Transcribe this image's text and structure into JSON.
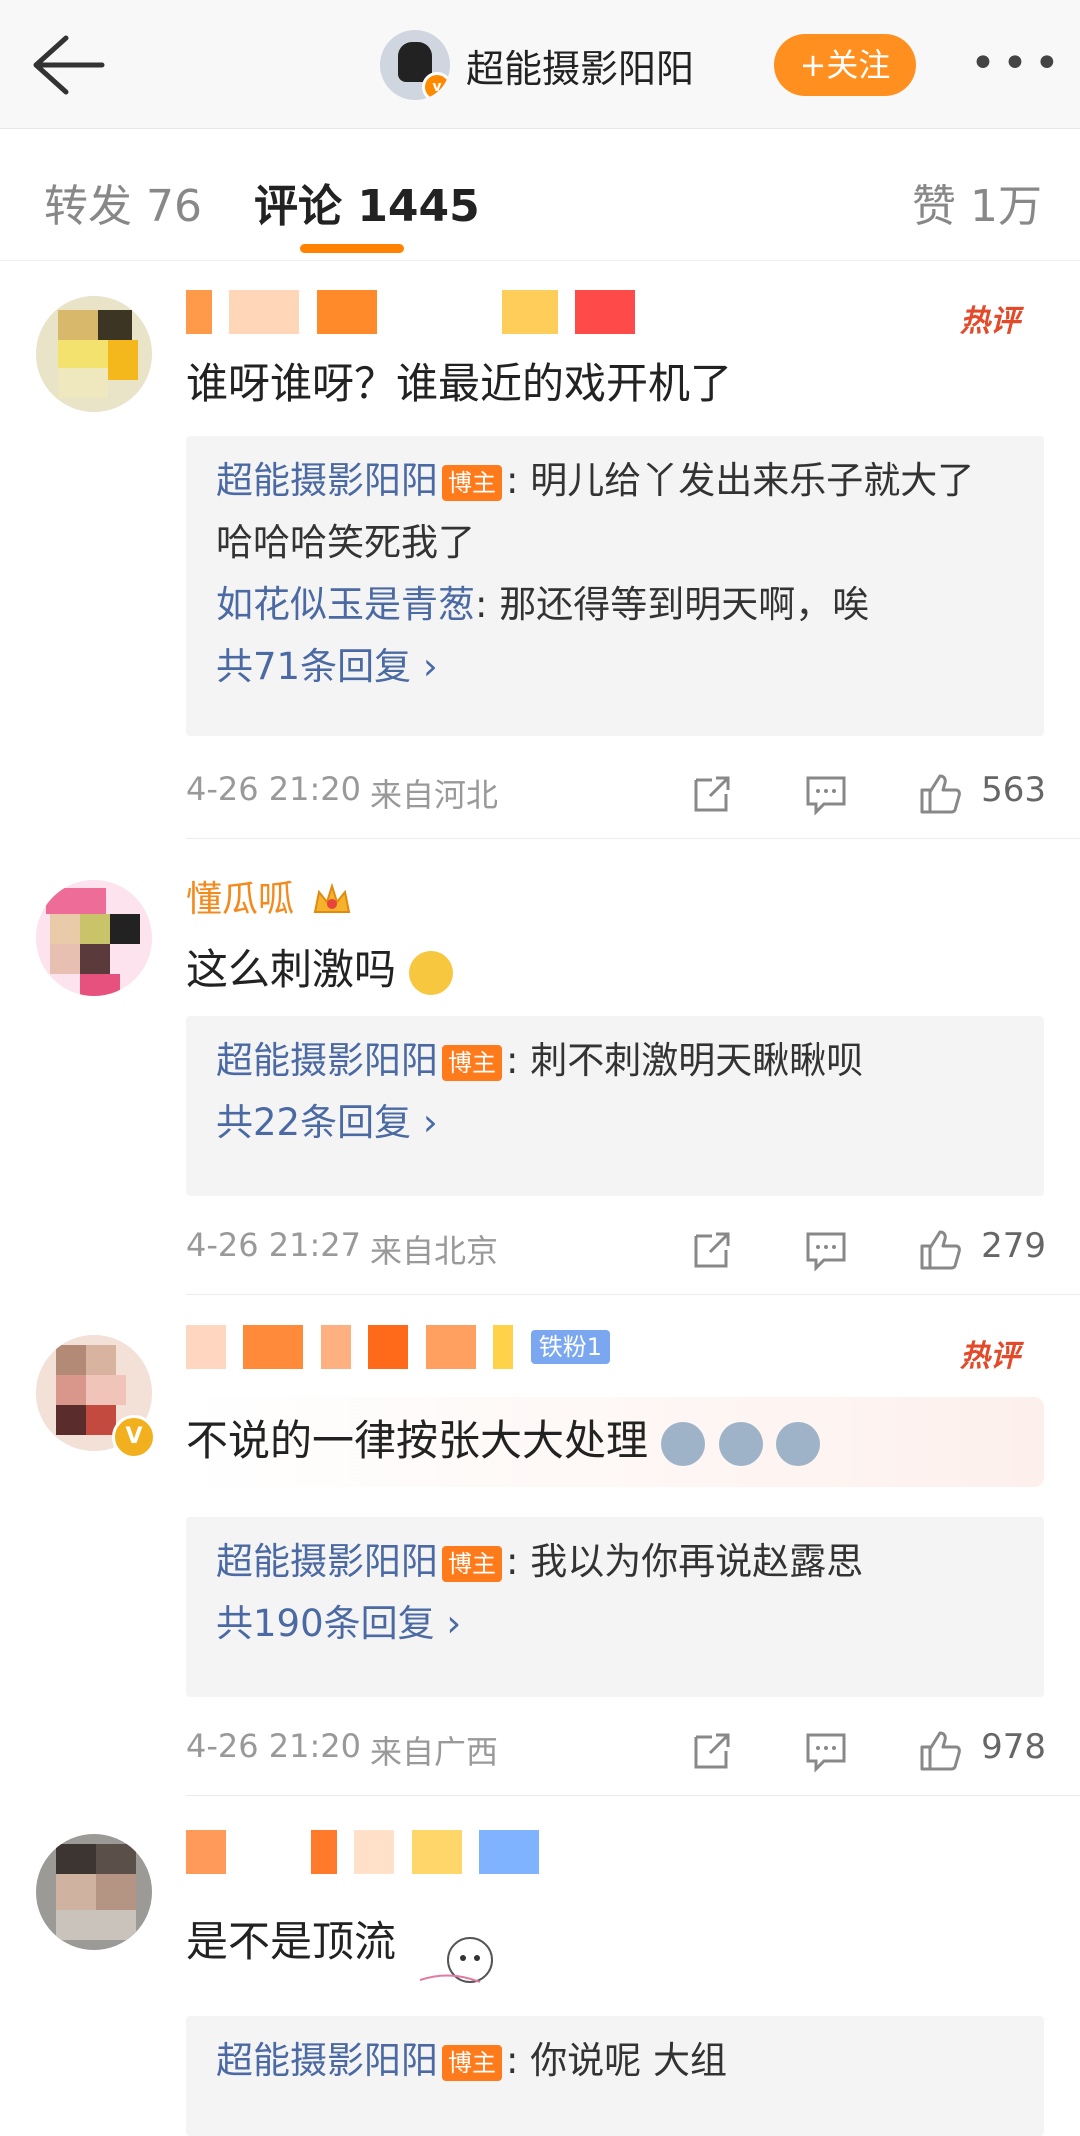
{
  "header": {
    "blogger_name": "超能摄影阳阳",
    "follow_label": "+关注",
    "more_label": "•••"
  },
  "tabs": [
    {
      "label": "转发 76"
    },
    {
      "label": "评论 1445"
    },
    {
      "label": "赞 1万"
    }
  ],
  "comments": [
    {
      "text": "谁呀谁呀？谁最近的戏开机了",
      "hot": "热评",
      "replies": [
        {
          "name": "超能摄影阳阳",
          "tag": "博主",
          "text": "明儿给丫发出来乐子就大了"
        },
        {
          "text_cont": "哈哈哈笑死我了"
        },
        {
          "name": "如花似玉是青葱",
          "text": "那还得等到明天啊，唉"
        }
      ],
      "reply_count": "共71条回复",
      "time": "4-26 21:20",
      "location": "来自河北",
      "likes": "563"
    },
    {
      "name": "懂瓜呱",
      "text": "这么刺激吗",
      "replies": [
        {
          "name": "超能摄影阳阳",
          "tag": "博主",
          "text": "刺不刺激明天瞅瞅呗"
        }
      ],
      "reply_count": "共22条回复",
      "time": "4-26 21:27",
      "location": "来自北京",
      "likes": "279"
    },
    {
      "fan_badge": "铁粉1",
      "hot": "热评",
      "text": "不说的一律按张大大处理",
      "replies": [
        {
          "name": "超能摄影阳阳",
          "tag": "博主",
          "text": "我以为你再说赵露思"
        }
      ],
      "reply_count": "共190条回复",
      "time": "4-26 21:20",
      "location": "来自广西",
      "likes": "978"
    },
    {
      "text": "是不是顶流",
      "replies": [
        {
          "name": "超能摄影阳阳",
          "tag": "博主",
          "text": "你说呢 大组"
        }
      ]
    }
  ],
  "colors": {
    "accent": "#ff8200",
    "link": "#4b6aa3",
    "username": "#f38a1e",
    "hot": "#e34a2a"
  },
  "icons": [
    "back-arrow-icon",
    "more-icon",
    "repost-icon",
    "comment-icon",
    "like-icon",
    "crown-icon",
    "verified-icon"
  ]
}
